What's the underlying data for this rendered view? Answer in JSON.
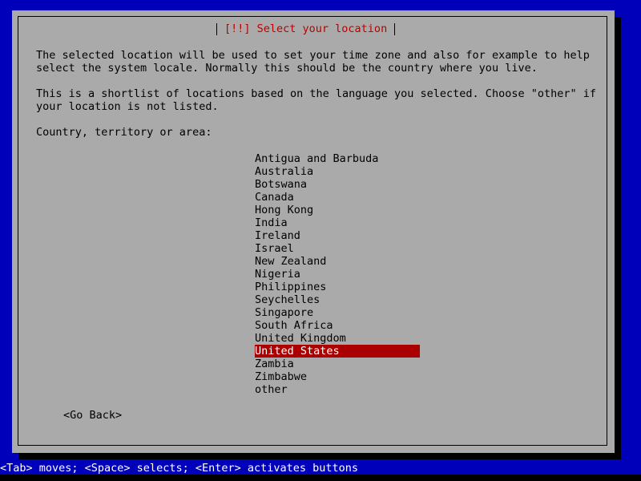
{
  "screen": {
    "background_color": "#0000bb",
    "dialog_background_color": "#aaaaaa",
    "title_color": "#bb0000",
    "highlight_background_color": "#aa0000",
    "highlight_text_color": "#ffffff"
  },
  "dialog": {
    "title": "[!!] Select your location",
    "paragraphs": [
      "The selected location will be used to set your time zone and also for example to help\nselect the system locale. Normally this should be the country where you live.",
      "This is a shortlist of locations based on the language you selected. Choose \"other\" if\nyour location is not listed."
    ],
    "list_label": "Country, territory or area:",
    "countries": [
      "Antigua and Barbuda",
      "Australia",
      "Botswana",
      "Canada",
      "Hong Kong",
      "India",
      "Ireland",
      "Israel",
      "New Zealand",
      "Nigeria",
      "Philippines",
      "Seychelles",
      "Singapore",
      "South Africa",
      "United Kingdom",
      "United States",
      "Zambia",
      "Zimbabwe",
      "other"
    ],
    "selected_country": "United States",
    "selected_index": 15,
    "go_back_button": "<Go Back>"
  },
  "statusbar": {
    "hint": "<Tab> moves; <Space> selects; <Enter> activates buttons"
  }
}
